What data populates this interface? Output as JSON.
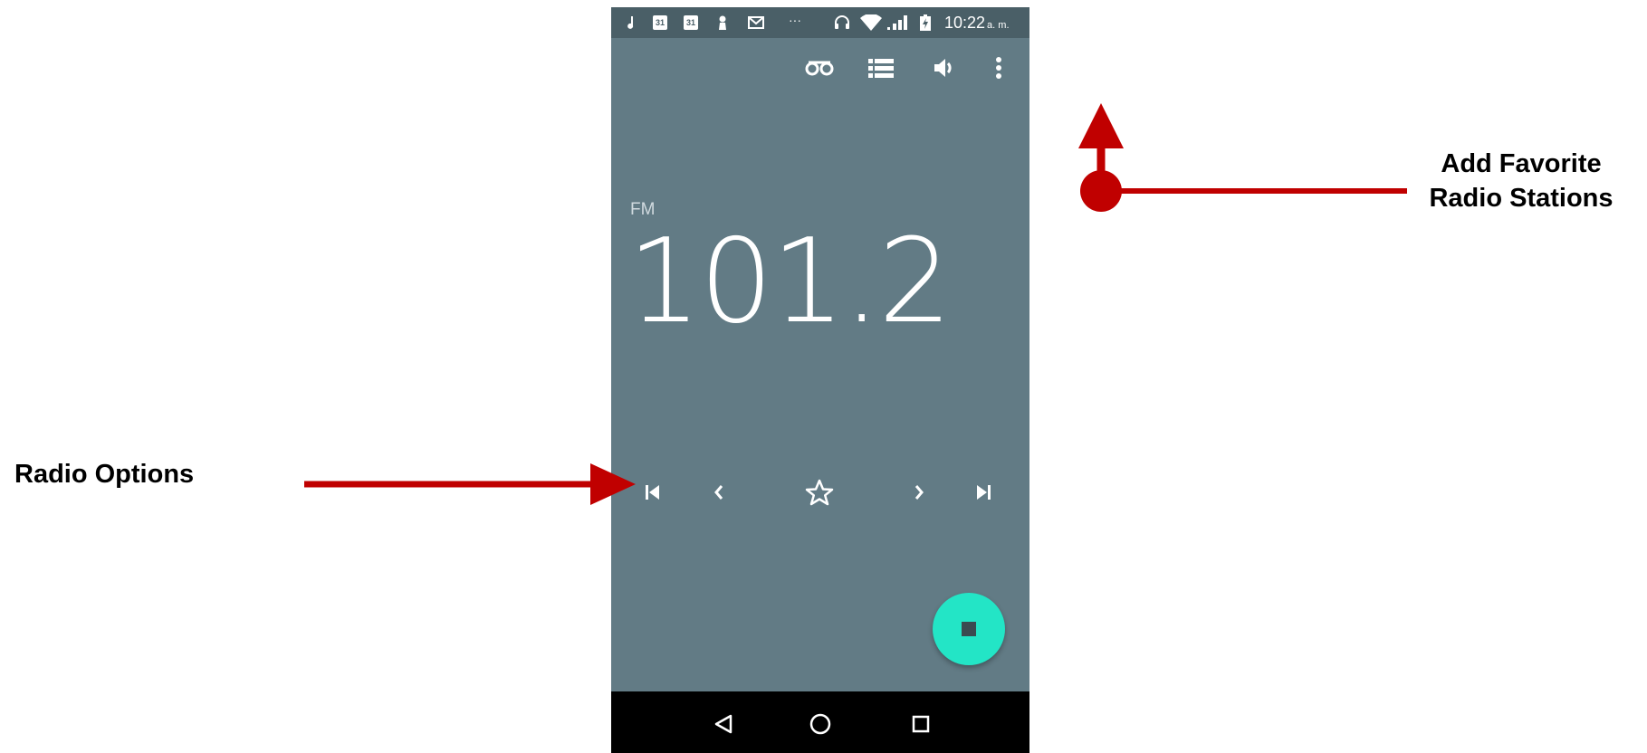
{
  "status_bar": {
    "calendar_day_1": "31",
    "calendar_day_2": "31",
    "overflow": "···",
    "time": "10:22",
    "ampm": "a. m.",
    "icons": [
      "music-note-icon",
      "calendar-icon",
      "calendar-icon",
      "keyhole-icon",
      "gmail-icon",
      "more-notifications-icon",
      "headset-icon",
      "wifi-icon",
      "signal-icon",
      "battery-charging-icon"
    ]
  },
  "action_bar": {
    "icons": [
      "recordings-icon",
      "station-list-icon",
      "speaker-icon",
      "overflow-menu-icon"
    ]
  },
  "radio": {
    "band": "FM",
    "frequency": "101.2"
  },
  "controls": {
    "icons": [
      "skip-previous-icon",
      "chevron-left-icon",
      "star-outline-icon",
      "chevron-right-icon",
      "skip-next-icon"
    ]
  },
  "fab": {
    "icon": "stop-icon",
    "color": "#23e5c6"
  },
  "nav_bar": {
    "icons": [
      "back-triangle-icon",
      "home-circle-icon",
      "recents-square-icon"
    ]
  },
  "annotations": {
    "add_favorite_line1": "Add Favorite",
    "add_favorite_line2": "Radio Stations",
    "radio_options": "Radio Options",
    "arrow_color": "#c00000"
  },
  "colors": {
    "screen_background": "#627b85",
    "status_bar": "#4a5f67",
    "nav_bar": "#000000"
  }
}
